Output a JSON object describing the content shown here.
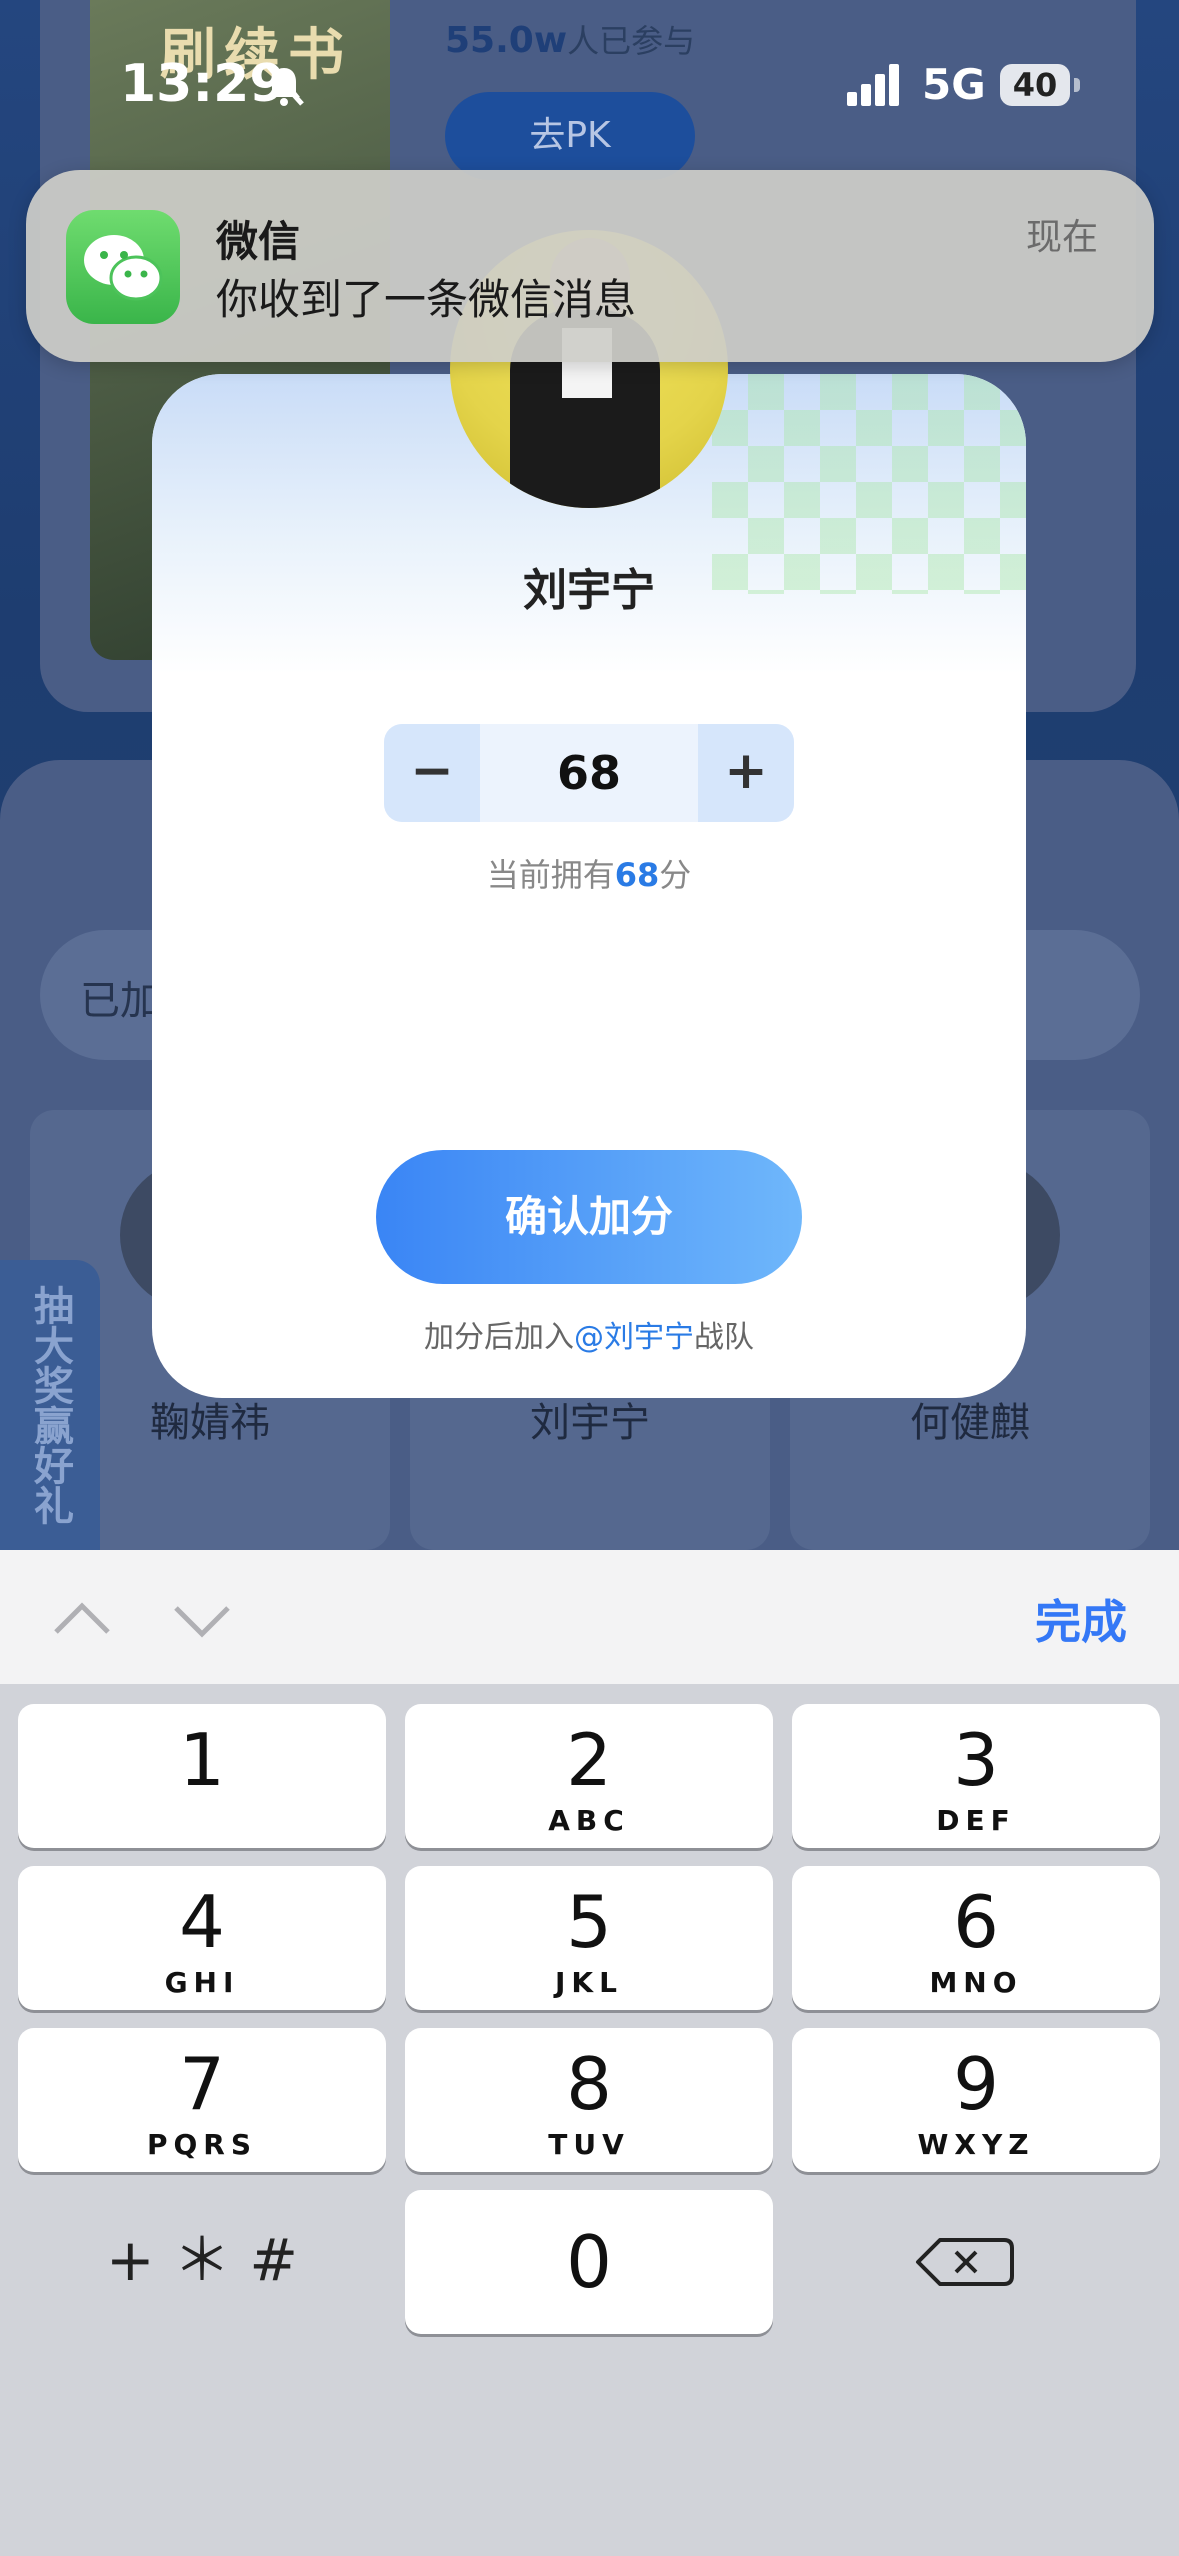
{
  "status_bar": {
    "time": "13:29",
    "network": "5G",
    "battery": "40"
  },
  "background": {
    "thumb_title": "刷续书",
    "participants_num": "55.0w",
    "participants_suffix": "人已参与",
    "pk_button": "去PK",
    "search_prefix": "已加",
    "side_banner": "抽大奖赢好礼",
    "candidates": [
      "鞠婧祎",
      "刘宇宁",
      "何健麒"
    ]
  },
  "notification": {
    "app": "微信",
    "message": "你收到了一条微信消息",
    "time": "现在",
    "icon": "wechat-icon"
  },
  "modal": {
    "name": "刘宇宁",
    "stepper": {
      "minus": "−",
      "value": "68",
      "plus": "+"
    },
    "owned": {
      "prefix": "当前拥有",
      "value": "68",
      "suffix": "分"
    },
    "confirm_label": "确认加分",
    "hint": {
      "prefix": "加分后加入",
      "team": "@刘宇宁",
      "suffix": "战队"
    }
  },
  "keyboard": {
    "done_label": "完成",
    "keys": [
      {
        "digit": "1",
        "letters": ""
      },
      {
        "digit": "2",
        "letters": "ABC"
      },
      {
        "digit": "3",
        "letters": "DEF"
      },
      {
        "digit": "4",
        "letters": "GHI"
      },
      {
        "digit": "5",
        "letters": "JKL"
      },
      {
        "digit": "6",
        "letters": "MNO"
      },
      {
        "digit": "7",
        "letters": "PQRS"
      },
      {
        "digit": "8",
        "letters": "TUV"
      },
      {
        "digit": "9",
        "letters": "WXYZ"
      },
      {
        "digit": "0",
        "letters": ""
      }
    ],
    "symbols_label": "+ ＊ #"
  },
  "colors": {
    "accent": "#2a7be5",
    "confirm_start": "#3a85f5",
    "confirm_end": "#6fb7fb",
    "keyboard_bg": "#d1d3d9"
  }
}
